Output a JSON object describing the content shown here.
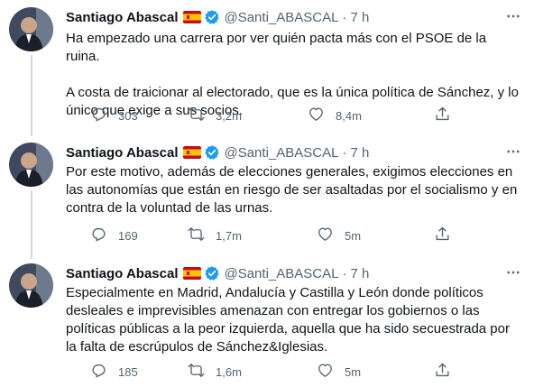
{
  "tweets": [
    {
      "name": "Santiago Abascal",
      "handle": "@Santi_ABASCAL",
      "separator": "·",
      "time": "7 h",
      "paragraphs": [
        "Ha empezado una carrera por ver quién pacta más con el PSOE de la ruina.",
        "A costa de traicionar al electorado, que es la única política de Sánchez, y lo único que exige a sus socios."
      ],
      "replies": "303",
      "retweets": "3,2m",
      "likes": "8,4m"
    },
    {
      "name": "Santiago Abascal",
      "handle": "@Santi_ABASCAL",
      "separator": "·",
      "time": "7 h",
      "paragraphs": [
        "Por este motivo, además de elecciones generales, exigimos elecciones en las autonomías que están en riesgo de ser asaltadas por el socialismo y en contra de la voluntad de las urnas."
      ],
      "replies": "169",
      "retweets": "1,7m",
      "likes": "5m"
    },
    {
      "name": "Santiago Abascal",
      "handle": "@Santi_ABASCAL",
      "separator": "·",
      "time": "7 h",
      "paragraphs": [
        "Especialmente en Madrid, Andalucía y Castilla y León donde políticos desleales e imprevisibles amenazan con entregar los gobiernos o las políticas públicas a la peor izquierda, aquella que ha sido secuestrada por la falta de escrúpulos de Sánchez&Iglesias."
      ],
      "replies": "185",
      "retweets": "1,6m",
      "likes": "5m"
    }
  ],
  "icons": {
    "reply": "reply-icon",
    "retweet": "retweet-icon",
    "like": "heart-icon",
    "share": "share-icon",
    "more": "more-icon",
    "verified": "verified-badge-icon",
    "flag": "spain-flag-icon"
  },
  "colors": {
    "text": "#0f1419",
    "secondary": "#536471",
    "verified": "#1d9bf0",
    "thread_line": "#cfd9de"
  }
}
